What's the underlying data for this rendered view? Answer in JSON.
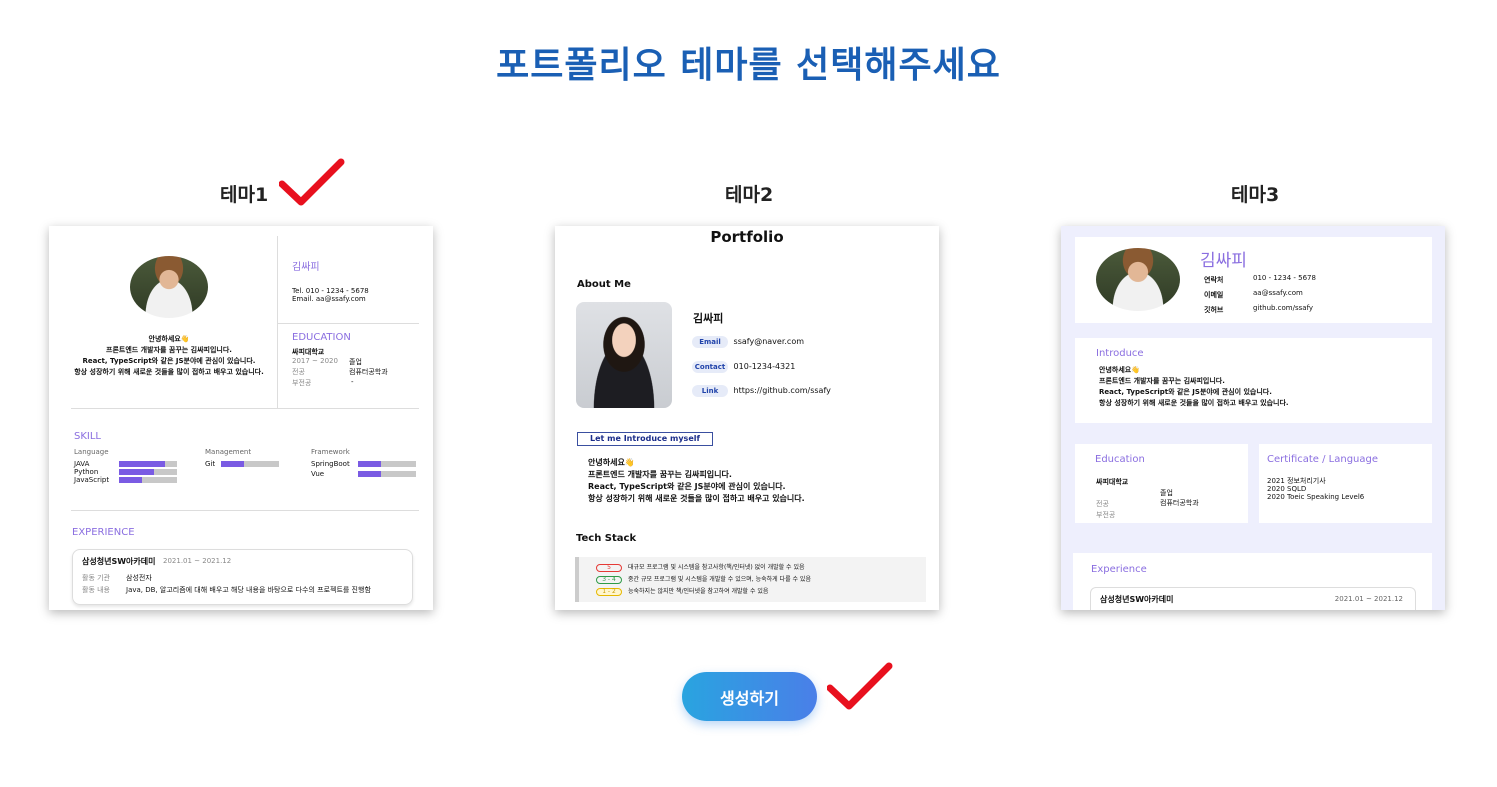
{
  "page": {
    "title": "포트폴리오 테마를 선택해주세요"
  },
  "themes": [
    {
      "label": "테마1",
      "selected": true
    },
    {
      "label": "테마2",
      "selected": false
    },
    {
      "label": "테마3",
      "selected": false
    }
  ],
  "accent_colors": {
    "title": "#1a5fb4",
    "check": "#e8101e",
    "button_from": "#29a4e0",
    "button_to": "#4a7fe8",
    "skill_bar": "#7a5be3"
  },
  "theme1": {
    "name": "김싸피",
    "tel": "Tel.   010 - 1234 - 5678",
    "email": "Email.   aa@ssafy.com",
    "intro": [
      "안녕하세요👋",
      "프론트엔드 개발자를 꿈꾸는 김싸피입니다.",
      "React, TypeScript와 같은 JS분야에 관심이 있습니다.",
      "항상 성장하기 위해 새로운 것들을 많이 접하고 배우고 있습니다."
    ],
    "education_heading": "EDUCATION",
    "school": "싸피대학교",
    "period": "2017 ~ 2020",
    "status": "졸업",
    "major_label": "전공",
    "major": "컴퓨터공학과",
    "minor_label": "부전공",
    "minor": "-",
    "skill_heading": "SKILL",
    "skill_groups": [
      {
        "title": "Language",
        "items": [
          {
            "name": "JAVA",
            "level": 0.8
          },
          {
            "name": "Python",
            "level": 0.6
          },
          {
            "name": "JavaScript",
            "level": 0.4
          }
        ]
      },
      {
        "title": "Management",
        "items": [
          {
            "name": "Git",
            "level": 0.4
          }
        ]
      },
      {
        "title": "Framework",
        "items": [
          {
            "name": "SpringBoot",
            "level": 0.4
          },
          {
            "name": "Vue",
            "level": 0.4
          }
        ]
      }
    ],
    "experience_heading": "EXPERIENCE",
    "exp_title": "삼성청년SW아카데미",
    "exp_period": "2021.01 ~ 2021.12",
    "exp_org_label": "활동 기관",
    "exp_org": "삼성전자",
    "exp_desc_label": "활동 내용",
    "exp_desc": "Java, DB, 알고리즘에 대해 배우고 해당 내용을 바탕으로 다수의 프로젝트를 진행함"
  },
  "theme2": {
    "title": "Portfolio",
    "about_heading": "About Me",
    "name": "김싸피",
    "email_label": "Email",
    "email": "ssafy@naver.com",
    "contact_label": "Contact",
    "contact": "010-1234-4321",
    "link_label": "Link",
    "link": "https://github.com/ssafy",
    "intro_heading": "Let me Introduce myself",
    "intro": [
      "안녕하세요👋",
      "프론트엔드 개발자를 꿈꾸는 김싸피입니다.",
      "React, TypeScript와 같은 JS분야에 관심이 있습니다.",
      "항상 성장하기 위해 새로운 것들을 많이 접하고 배우고 있습니다."
    ],
    "tech_heading": "Tech Stack",
    "levels": [
      {
        "badge": "5",
        "text": "대규모 프로그램 및 시스템을 참고사항(책/인터넷) 없이 개발할 수 있음",
        "color": "#e53935"
      },
      {
        "badge": "3 - 4",
        "text": "중간 규모 프로그램 및 시스템을 개발할 수 있으며, 능숙하게 다룰 수 있음",
        "color": "#2e9b47"
      },
      {
        "badge": "1 - 2",
        "text": "능숙하지는 않지만 책/인터넷을 참고하여 개발할 수 있음",
        "color": "#e6b800"
      }
    ]
  },
  "theme3": {
    "name": "김싸피",
    "contact_label": "연락처",
    "contact": "010 - 1234 - 5678",
    "email_label": "이메일",
    "email": "aa@ssafy.com",
    "github_label": "깃허브",
    "github": "github.com/ssafy",
    "introduce_heading": "Introduce",
    "intro": [
      "안녕하세요👋",
      "프론트엔드 개발자를 꿈꾸는 김싸피입니다.",
      "React, TypeScript와 같은 JS분야에 관심이 있습니다.",
      "항상 성장하기 위해 새로운 것들을 많이 접하고 배우고 있습니다."
    ],
    "education_heading": "Education",
    "school": "싸피대학교",
    "status": "졸업",
    "major_label": "전공",
    "major": "컴퓨터공학과",
    "minor_label": "부전공",
    "cert_heading": "Certificate / Language",
    "certs": [
      "2021 정보처리기사",
      "2020 SQLD",
      "2020 Toeic Speaking Level6"
    ],
    "experience_heading": "Experience",
    "exp_title": "삼성청년SW아카데미",
    "exp_period": "2021.01 ~ 2021.12"
  },
  "generate_button": {
    "label": "생성하기",
    "confirmed": true
  }
}
